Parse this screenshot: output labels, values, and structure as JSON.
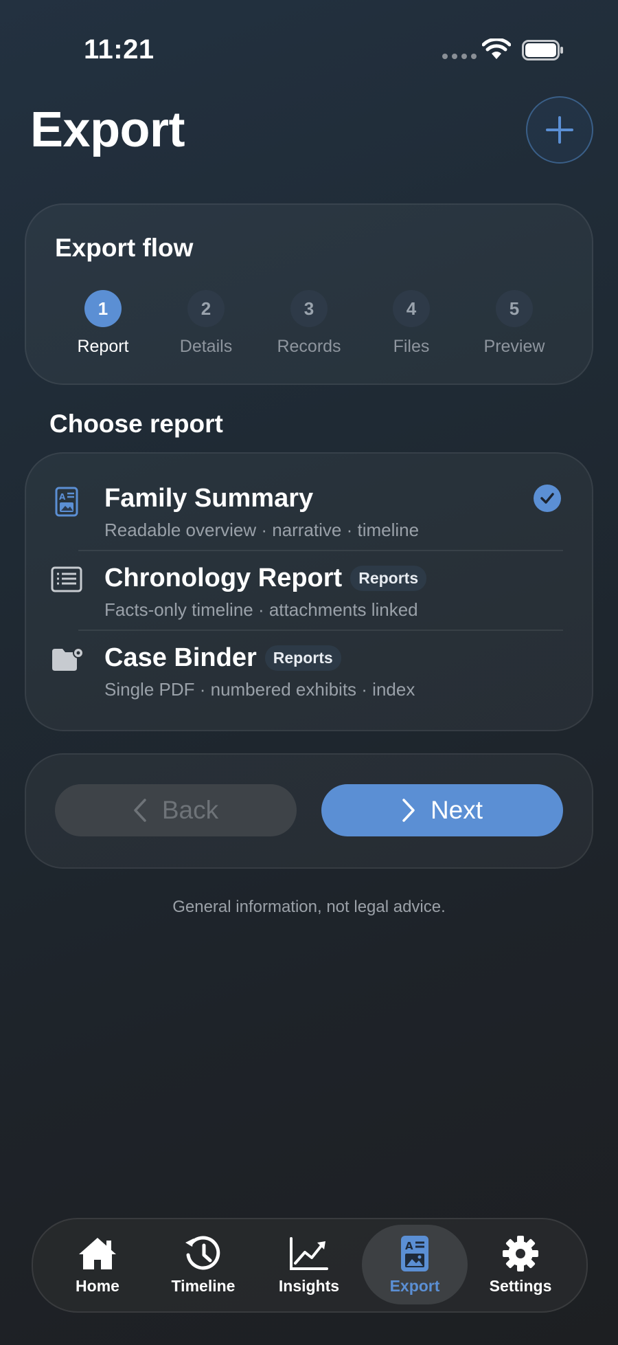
{
  "status_bar": {
    "time": "11:21"
  },
  "header": {
    "title": "Export"
  },
  "flow": {
    "title": "Export flow",
    "steps": [
      {
        "number": "1",
        "label": "Report",
        "active": true
      },
      {
        "number": "2",
        "label": "Details",
        "active": false
      },
      {
        "number": "3",
        "label": "Records",
        "active": false
      },
      {
        "number": "4",
        "label": "Files",
        "active": false
      },
      {
        "number": "5",
        "label": "Preview",
        "active": false
      }
    ]
  },
  "reports": {
    "section_title": "Choose report",
    "items": [
      {
        "name": "Family Summary",
        "subtitle": "Readable overview · narrative · timeline",
        "badge": "",
        "selected": true,
        "icon": "document-image-icon"
      },
      {
        "name": "Chronology Report",
        "subtitle": "Facts-only timeline · attachments linked",
        "badge": "Reports",
        "selected": false,
        "icon": "list-text-icon"
      },
      {
        "name": "Case Binder",
        "subtitle": "Single PDF · numbered exhibits · index",
        "badge": "Reports",
        "selected": false,
        "icon": "folder-gear-icon"
      }
    ]
  },
  "navigation": {
    "back_label": "Back",
    "next_label": "Next"
  },
  "disclaimer": "General information, not legal advice.",
  "tabbar": {
    "items": [
      {
        "label": "Home",
        "icon": "house-icon"
      },
      {
        "label": "Timeline",
        "icon": "clock-history-icon"
      },
      {
        "label": "Insights",
        "icon": "chart-line-icon"
      },
      {
        "label": "Export",
        "icon": "document-image-icon",
        "active": true
      },
      {
        "label": "Settings",
        "icon": "gear-icon"
      }
    ]
  },
  "colors": {
    "accent": "#5b8fd4",
    "background": "#1f2a34",
    "card": "#2a3138"
  }
}
